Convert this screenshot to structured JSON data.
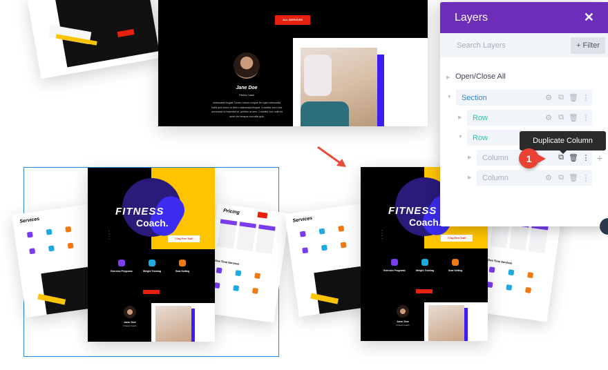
{
  "top_preview": {
    "button": "ALL SERVICES",
    "name": "Jane Doe",
    "role": "Fitness Coach",
    "bio": "malesuada feugiat. Donec rutrum congue leo eget malesuada. Nulla quis lorem ut libero malesuada feugiat. Curabitur arcu erat, accumsan id imperdiet et, porttitor at sem. Curabitur non nulla sit amet nisl tempus convallis quis."
  },
  "mockup": {
    "hero_title_1": "FITNESS",
    "hero_title_2": "Coach.",
    "trial_button": "7 Day Free Trail!",
    "features": [
      "Exercise Programs",
      "Weight Training",
      "Goal Setting"
    ],
    "feature_colors": [
      "#7b3cf0",
      "#1fa9e1",
      "#f07a12"
    ],
    "services_title": "Services",
    "pricing_title": "Pricing",
    "one_time": "One Time Services",
    "name": "Jane Doe",
    "role": "Fitness Coach"
  },
  "layers": {
    "title": "Layers",
    "close": "✕",
    "search_placeholder": "Search Layers",
    "filter": "+ Filter",
    "open_close": "Open/Close All",
    "tree": [
      {
        "label": "Section",
        "type": "section"
      },
      {
        "label": "Row",
        "type": "row"
      },
      {
        "label": "Row",
        "type": "row"
      },
      {
        "label": "Column",
        "type": "column"
      },
      {
        "label": "Column",
        "type": "column"
      }
    ],
    "tooltip": "Duplicate Column",
    "step_badge": "1",
    "add": "+"
  },
  "colors": {
    "accent": "#6c2eb9",
    "section": "#2b87da",
    "row": "#29c4a9",
    "column": "#a6b0bd",
    "badge": "#e94235",
    "page_yellow": "#ffc400",
    "cta_red": "#e8210f"
  }
}
